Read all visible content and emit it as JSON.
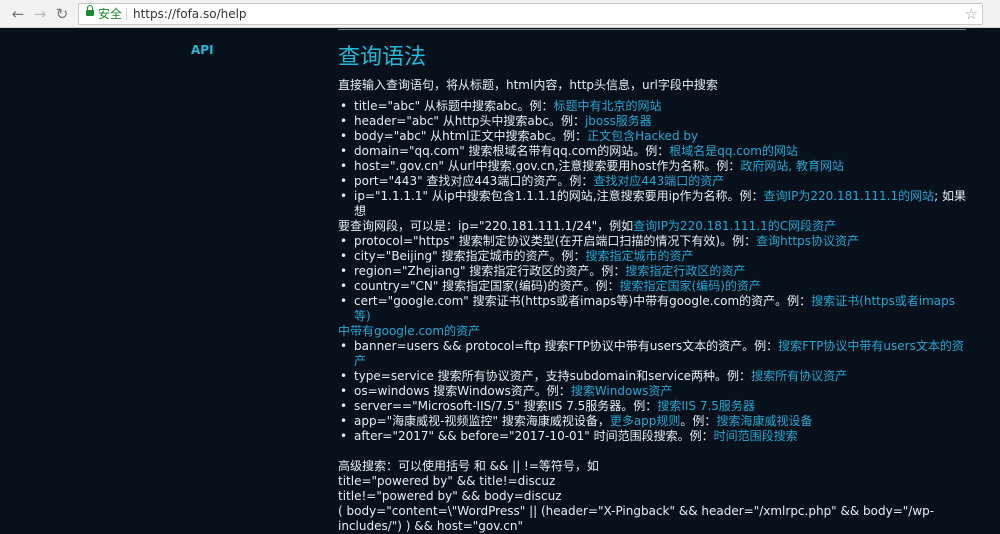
{
  "browser": {
    "secure_label": "安全",
    "url": "https://fofa.so/help"
  },
  "sidebar": {
    "api_label": "API"
  },
  "content": {
    "title": "查询语法",
    "intro": "直接输入查询语句，将从标题，html内容，http头信息，url字段中搜索",
    "items": [
      {
        "text": "title=\"abc\" 从标题中搜索abc。例：",
        "link": "标题中有北京的网站"
      },
      {
        "text": "header=\"abc\" 从http头中搜索abc。例：",
        "link": "jboss服务器"
      },
      {
        "text": "body=\"abc\" 从html正文中搜索abc。例：",
        "link": "正文包含Hacked by"
      },
      {
        "text": "domain=\"qq.com\" 搜索根域名带有qq.com的网站。例：",
        "link": "根域名是qq.com的网站"
      },
      {
        "text": "host=\".gov.cn\" 从url中搜索.gov.cn,注意搜索要用host作为名称。例：",
        "link": "政府网站, 教育网站"
      },
      {
        "text": "port=\"443\" 查找对应443端口的资产。例：",
        "link": "查找对应443端口的资产"
      },
      {
        "text": "ip=\"1.1.1.1\" 从ip中搜索包含1.1.1.1的网站,注意搜索要用ip作为名称。例：",
        "link": "查询IP为220.181.111.1的网站",
        "after": "; 如果想"
      },
      {
        "continuation": true,
        "text": "要查询网段，可以是：ip=\"220.181.111.1/24\"，例如",
        "link": "查询IP为220.181.111.1的C网段资产"
      },
      {
        "text": "protocol=\"https\" 搜索制定协议类型(在开启端口扫描的情况下有效)。例：",
        "link": "查询https协议资产"
      },
      {
        "text": "city=\"Beijing\" 搜索指定城市的资产。例：",
        "link": "搜索指定城市的资产"
      },
      {
        "text": "region=\"Zhejiang\" 搜索指定行政区的资产。例：",
        "link": "搜索指定行政区的资产"
      },
      {
        "text": "country=\"CN\" 搜索指定国家(编码)的资产。例：",
        "link": "搜索指定国家(编码)的资产"
      },
      {
        "text": "cert=\"google.com\" 搜索证书(https或者imaps等)中带有google.com的资产。例：",
        "link": "搜索证书(https或者imaps等)"
      },
      {
        "continuation": true,
        "text": "",
        "link": "中带有google.com的资产"
      },
      {
        "text": "banner=users && protocol=ftp 搜索FTP协议中带有users文本的资产。例：",
        "link": "搜索FTP协议中带有users文本的资产"
      },
      {
        "text": "type=service 搜索所有协议资产，支持subdomain和service两种。例：",
        "link": "搜索所有协议资产"
      },
      {
        "text": "os=windows 搜索Windows资产。例：",
        "link": "搜索Windows资产"
      },
      {
        "text": "server==\"Microsoft-IIS/7.5\" 搜索IIS 7.5服务器。例：",
        "link": "搜索IIS 7.5服务器"
      },
      {
        "text": "app=\"海康威视-视频监控\" 搜索海康威视设备，",
        "link": "更多app规则",
        "after": "。例：",
        "link2": "搜索海康威视设备"
      },
      {
        "text": "after=\"2017\" && before=\"2017-10-01\" 时间范围段搜索。例：",
        "link": "时间范围段搜索"
      }
    ],
    "advanced": [
      "高级搜索：可以使用括号 和 && || !=等符号，如",
      "title=\"powered by\" && title!=discuz",
      "title!=\"powered by\" && body=discuz",
      "( body=\"content=\\\"WordPress\" || (header=\"X-Pingback\" && header=\"/xmlrpc.php\" && body=\"/wp-",
      "includes/\") ) && host=\"gov.cn\""
    ]
  },
  "colors": {
    "background": "#07111c",
    "accent": "#22b9d6",
    "link": "#24a7d1",
    "text": "#e8edf2"
  }
}
